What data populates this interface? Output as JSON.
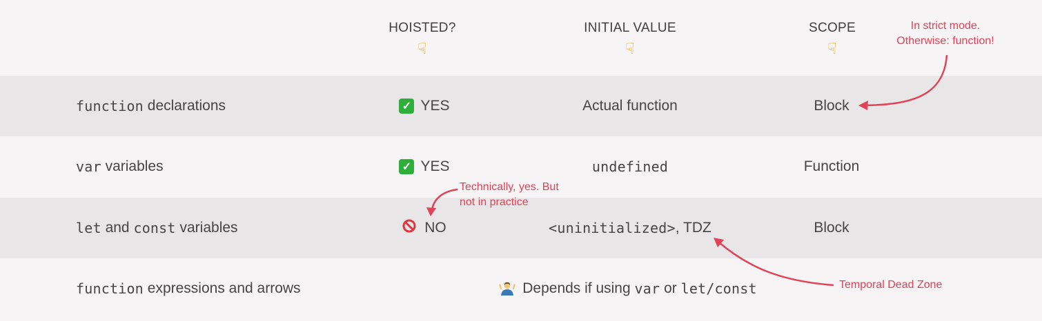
{
  "headers": {
    "hoisted": "HOISTED?",
    "initial_value": "INITIAL VALUE",
    "scope": "SCOPE"
  },
  "rows": [
    {
      "name_code": "function",
      "name_text": " declarations",
      "hoisted_icon": "check-mark-icon",
      "hoisted": "YES",
      "initial_value": "Actual function",
      "scope": "Block"
    },
    {
      "name_code": "var",
      "name_text": " variables",
      "hoisted_icon": "check-mark-icon",
      "hoisted": "YES",
      "initial_value_code": "undefined",
      "scope": "Function"
    },
    {
      "name_code_1": "let",
      "name_text_1": " and ",
      "name_code_2": "const",
      "name_text_2": " variables",
      "hoisted_icon": "no-entry-icon",
      "hoisted": "NO",
      "initial_value_code": "<uninitialized>",
      "initial_value_text": ", TDZ",
      "scope": "Block"
    },
    {
      "name_code": "function",
      "name_text": " expressions and arrows",
      "icon": "shrug-icon",
      "text_1": "Depends if using ",
      "code_1": "var",
      "text_2": " or ",
      "code_2": "let/const"
    }
  ],
  "annotations": {
    "strict_mode_line1": "In strict mode.",
    "strict_mode_line2": "Otherwise: function!",
    "technically_line1": "Technically, yes. But",
    "technically_line2": "not in practice",
    "tdz": "Temporal Dead Zone"
  },
  "colors": {
    "background": "#f6f4f4",
    "row_shade": "#e8e6e6",
    "annotation": "#e04358",
    "check_green": "#2fae3c"
  }
}
